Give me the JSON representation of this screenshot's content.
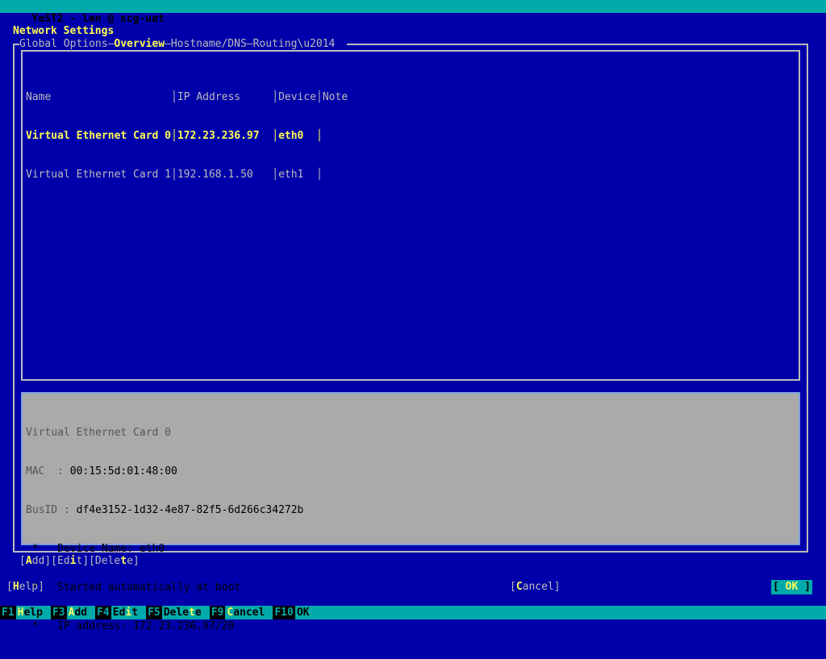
{
  "window": {
    "title": "YaST2 - lan @ scg-uat"
  },
  "page": {
    "heading": "Network Settings"
  },
  "tabs": [
    {
      "label": "Global Options",
      "active": false
    },
    {
      "label": "Overview",
      "active": true
    },
    {
      "label": "Hostname/DNS",
      "active": false
    },
    {
      "label": "Routing",
      "active": false
    }
  ],
  "tab_separator": "—",
  "table": {
    "columns": [
      "Name",
      "IP Address",
      "Device",
      "Note"
    ],
    "header_line": "Name                   │IP Address     │Device│Note",
    "rows": [
      {
        "name": "Virtual Ethernet Card 0",
        "ip_address": "172.23.236.97",
        "device": "eth0",
        "note": "",
        "selected": true,
        "line": "Virtual Ethernet Card 0│172.23.236.97  │eth0  │"
      },
      {
        "name": "Virtual Ethernet Card 1",
        "ip_address": "192.168.1.50",
        "device": "eth1",
        "note": "",
        "selected": false,
        "line": "Virtual Ethernet Card 1│192.168.1.50   │eth1  │"
      }
    ]
  },
  "detail": {
    "device_title": "Virtual Ethernet Card 0",
    "mac_label": "MAC  :",
    "mac_value": "00:15:5d:01:48:00",
    "busid_label": "BusID :",
    "busid_value": "df4e3152-1d32-4e87-82f5-6d266c34272b",
    "bullet": "*",
    "bullets": [
      "Device Name: eth0",
      "Started automatically at boot",
      "IP address: 172.23.236.97/20"
    ]
  },
  "table_actions": {
    "add": "[Add]",
    "add_pre": "[",
    "add_hot": "A",
    "add_post": "dd]",
    "edit_pre": "[Ed",
    "edit_hot": "i",
    "edit_post": "t]",
    "delete_pre": "[Dele",
    "delete_hot": "t",
    "delete_post": "e]"
  },
  "dialog_buttons": {
    "help_pre": "[",
    "help_hot": "H",
    "help_post": "elp]",
    "cancel_pre": "[",
    "cancel_hot": "C",
    "cancel_post": "ancel]",
    "ok_left": "[ ",
    "ok_label": "OK",
    "ok_right": " ]"
  },
  "function_keys": [
    {
      "key": "F1",
      "label": "Help",
      "hot_index": 0
    },
    {
      "key": "F3",
      "label": "Add",
      "hot_index": 0
    },
    {
      "key": "F4",
      "label": "Edit",
      "hot_index": 0
    },
    {
      "key": "F5",
      "label": "Delete",
      "hot_index": 0
    },
    {
      "key": "F9",
      "label": "Cancel",
      "hot_index": 0
    },
    {
      "key": "F10",
      "label": "OK",
      "hot_index": -1
    }
  ],
  "colors": {
    "background": "#0000aa",
    "accent_cyan": "#00aaaa",
    "highlight_yellow": "#ffff55",
    "border_gray": "#bbbbbb",
    "panel_gray": "#aaaaaa",
    "panel_border": "#7f9fdf",
    "black": "#000000"
  }
}
